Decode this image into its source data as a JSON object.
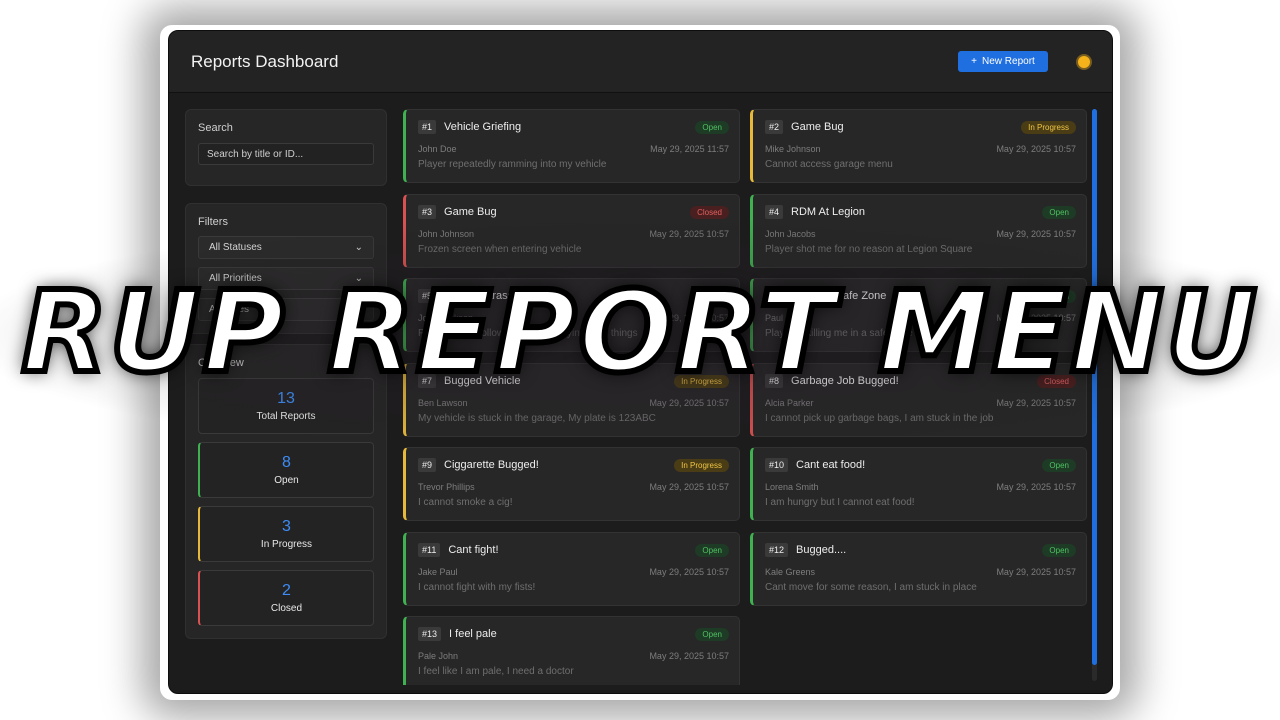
{
  "header": {
    "title": "Reports Dashboard",
    "new_report_label": "New Report",
    "new_report_icon": "+"
  },
  "search": {
    "heading": "Search",
    "placeholder": "Search by title or ID..."
  },
  "filters": {
    "heading": "Filters",
    "status": "All Statuses",
    "priority": "All Priorities",
    "dates": "All Dates"
  },
  "overview": {
    "heading": "Overview",
    "total": {
      "value": "13",
      "label": "Total Reports"
    },
    "open": {
      "value": "8",
      "label": "Open"
    },
    "in_progress": {
      "value": "3",
      "label": "In Progress"
    },
    "closed": {
      "value": "2",
      "label": "Closed"
    }
  },
  "reports": [
    {
      "id": "#1",
      "title": "Vehicle Griefing",
      "status": "Open",
      "user": "John Doe",
      "date": "May 29, 2025 11:57",
      "desc": "Player repeatedly ramming into my vehicle"
    },
    {
      "id": "#2",
      "title": "Game Bug",
      "status": "In Progress",
      "user": "Mike Johnson",
      "date": "May 29, 2025 10:57",
      "desc": "Cannot access garage menu"
    },
    {
      "id": "#3",
      "title": "Game Bug",
      "status": "Closed",
      "user": "John Johnson",
      "date": "May 29, 2025 10:57",
      "desc": "Frozen screen when entering vehicle"
    },
    {
      "id": "#4",
      "title": "RDM At Legion",
      "status": "Open",
      "user": "John Jacobs",
      "date": "May 29, 2025 10:57",
      "desc": "Player shot me for no reason at Legion Square"
    },
    {
      "id": "#5",
      "title": "Player Harassment",
      "status": "Open",
      "user": "John Jackson",
      "date": "May 29, 2025 10:57",
      "desc": "Player keeps following me and saying rude things"
    },
    {
      "id": "#6",
      "title": "Killing In Safe Zone",
      "status": "Open",
      "user": "Paul Smith",
      "date": "May 29, 2025 10:57",
      "desc": "Player is killing me in a safe zone"
    },
    {
      "id": "#7",
      "title": "Bugged Vehicle",
      "status": "In Progress",
      "user": "Ben Lawson",
      "date": "May 29, 2025 10:57",
      "desc": "My vehicle is stuck in the garage, My plate is 123ABC"
    },
    {
      "id": "#8",
      "title": "Garbage Job Bugged!",
      "status": "Closed",
      "user": "Alcia Parker",
      "date": "May 29, 2025 10:57",
      "desc": "I cannot pick up garbage bags, I am stuck in the job"
    },
    {
      "id": "#9",
      "title": "Ciggarette Bugged!",
      "status": "In Progress",
      "user": "Trevor Phillips",
      "date": "May 29, 2025 10:57",
      "desc": "I cannot smoke a cig!"
    },
    {
      "id": "#10",
      "title": "Cant eat food!",
      "status": "Open",
      "user": "Lorena Smith",
      "date": "May 29, 2025 10:57",
      "desc": "I am hungry but I cannot eat food!"
    },
    {
      "id": "#11",
      "title": "Cant fight!",
      "status": "Open",
      "user": "Jake Paul",
      "date": "May 29, 2025 10:57",
      "desc": "I cannot fight with my fists!"
    },
    {
      "id": "#12",
      "title": "Bugged....",
      "status": "Open",
      "user": "Kale Greens",
      "date": "May 29, 2025 10:57",
      "desc": "Cant move for some reason, I am stuck in place"
    },
    {
      "id": "#13",
      "title": "I feel pale",
      "status": "Open",
      "user": "Pale John",
      "date": "May 29, 2025 10:57",
      "desc": "I feel like I am pale, I need a doctor"
    }
  ],
  "overlay": {
    "title": "RUP REPORT MENU"
  },
  "colors": {
    "accent": "#1f6fe0",
    "open": "#3fb150",
    "in_progress": "#e6b93a",
    "closed": "#d95252"
  }
}
